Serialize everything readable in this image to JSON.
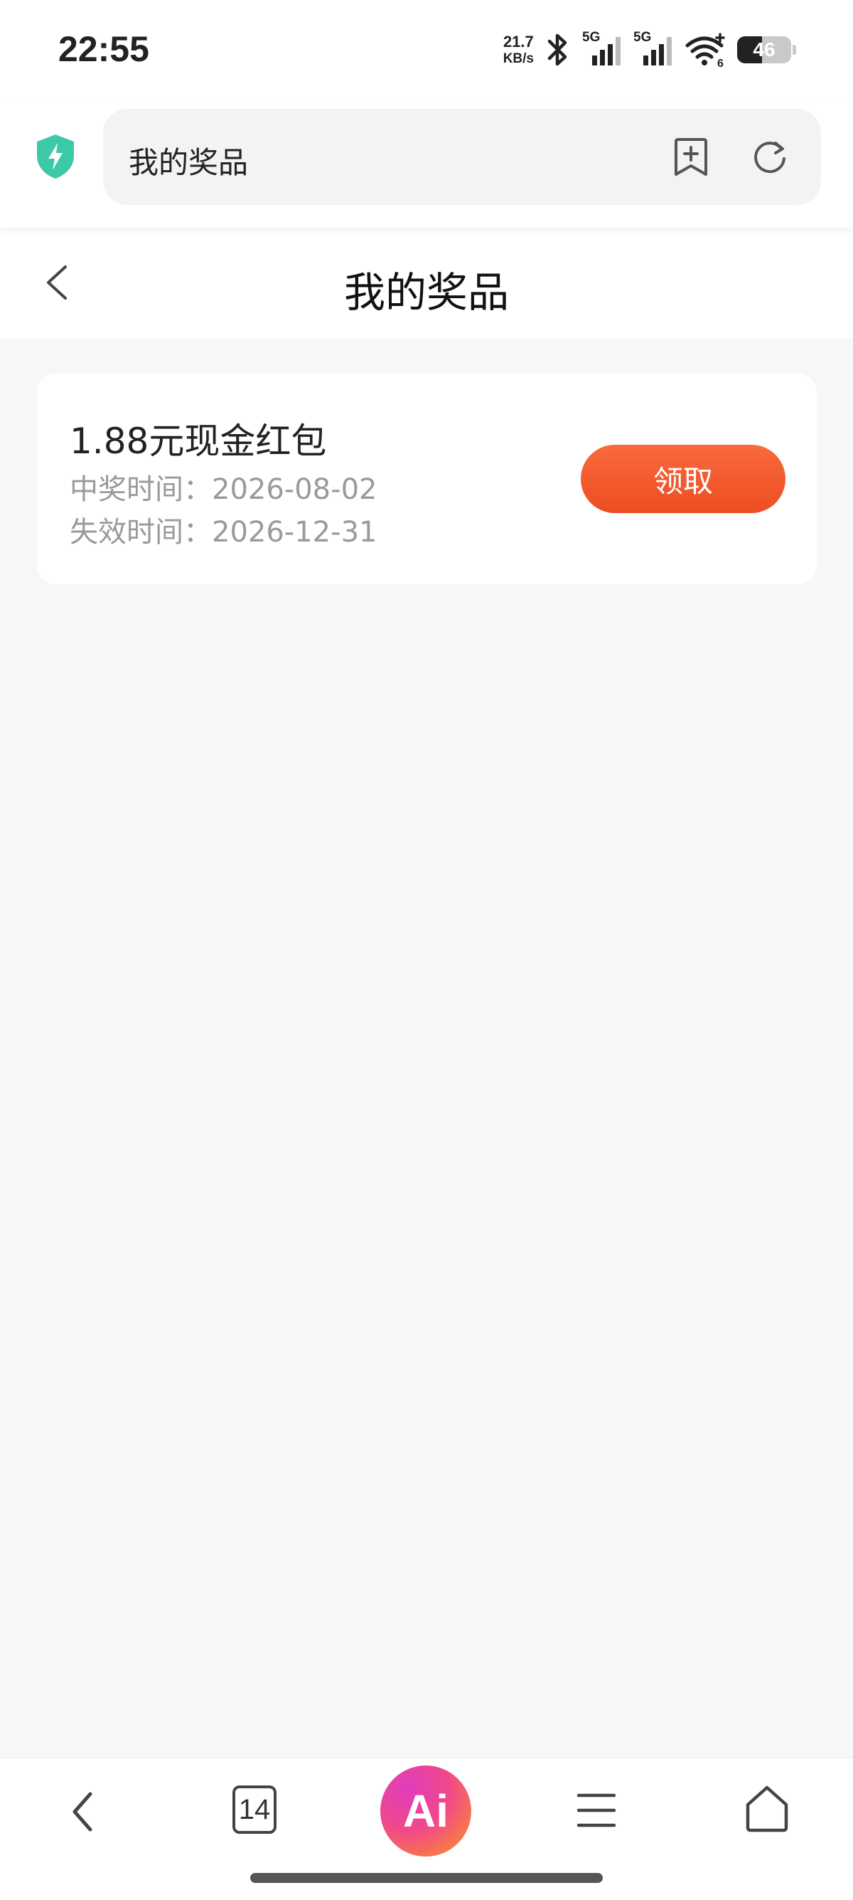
{
  "status_bar": {
    "time": "22:55",
    "net_speed_value": "21.7",
    "net_speed_unit": "KB/s",
    "sim1_label": "5G",
    "sim2_label": "5G",
    "wifi_label": "6",
    "battery_level": "46",
    "battery_fraction": 0.46
  },
  "browser": {
    "url_text": "我的奖品",
    "security_icon": "shield-bolt-icon",
    "accent_color": "#34c9a8"
  },
  "header": {
    "title": "我的奖品"
  },
  "prizes": [
    {
      "name": "1.88元现金红包",
      "win_time_label": "中奖时间：",
      "win_time": "2026-08-02",
      "expire_time_label": "失效时间：",
      "expire_time": "2026-12-31",
      "button_label": "领取",
      "button_color": "#f25a2c"
    }
  ],
  "bottom_nav": {
    "tab_count": "14",
    "ai_label": "Ai"
  }
}
